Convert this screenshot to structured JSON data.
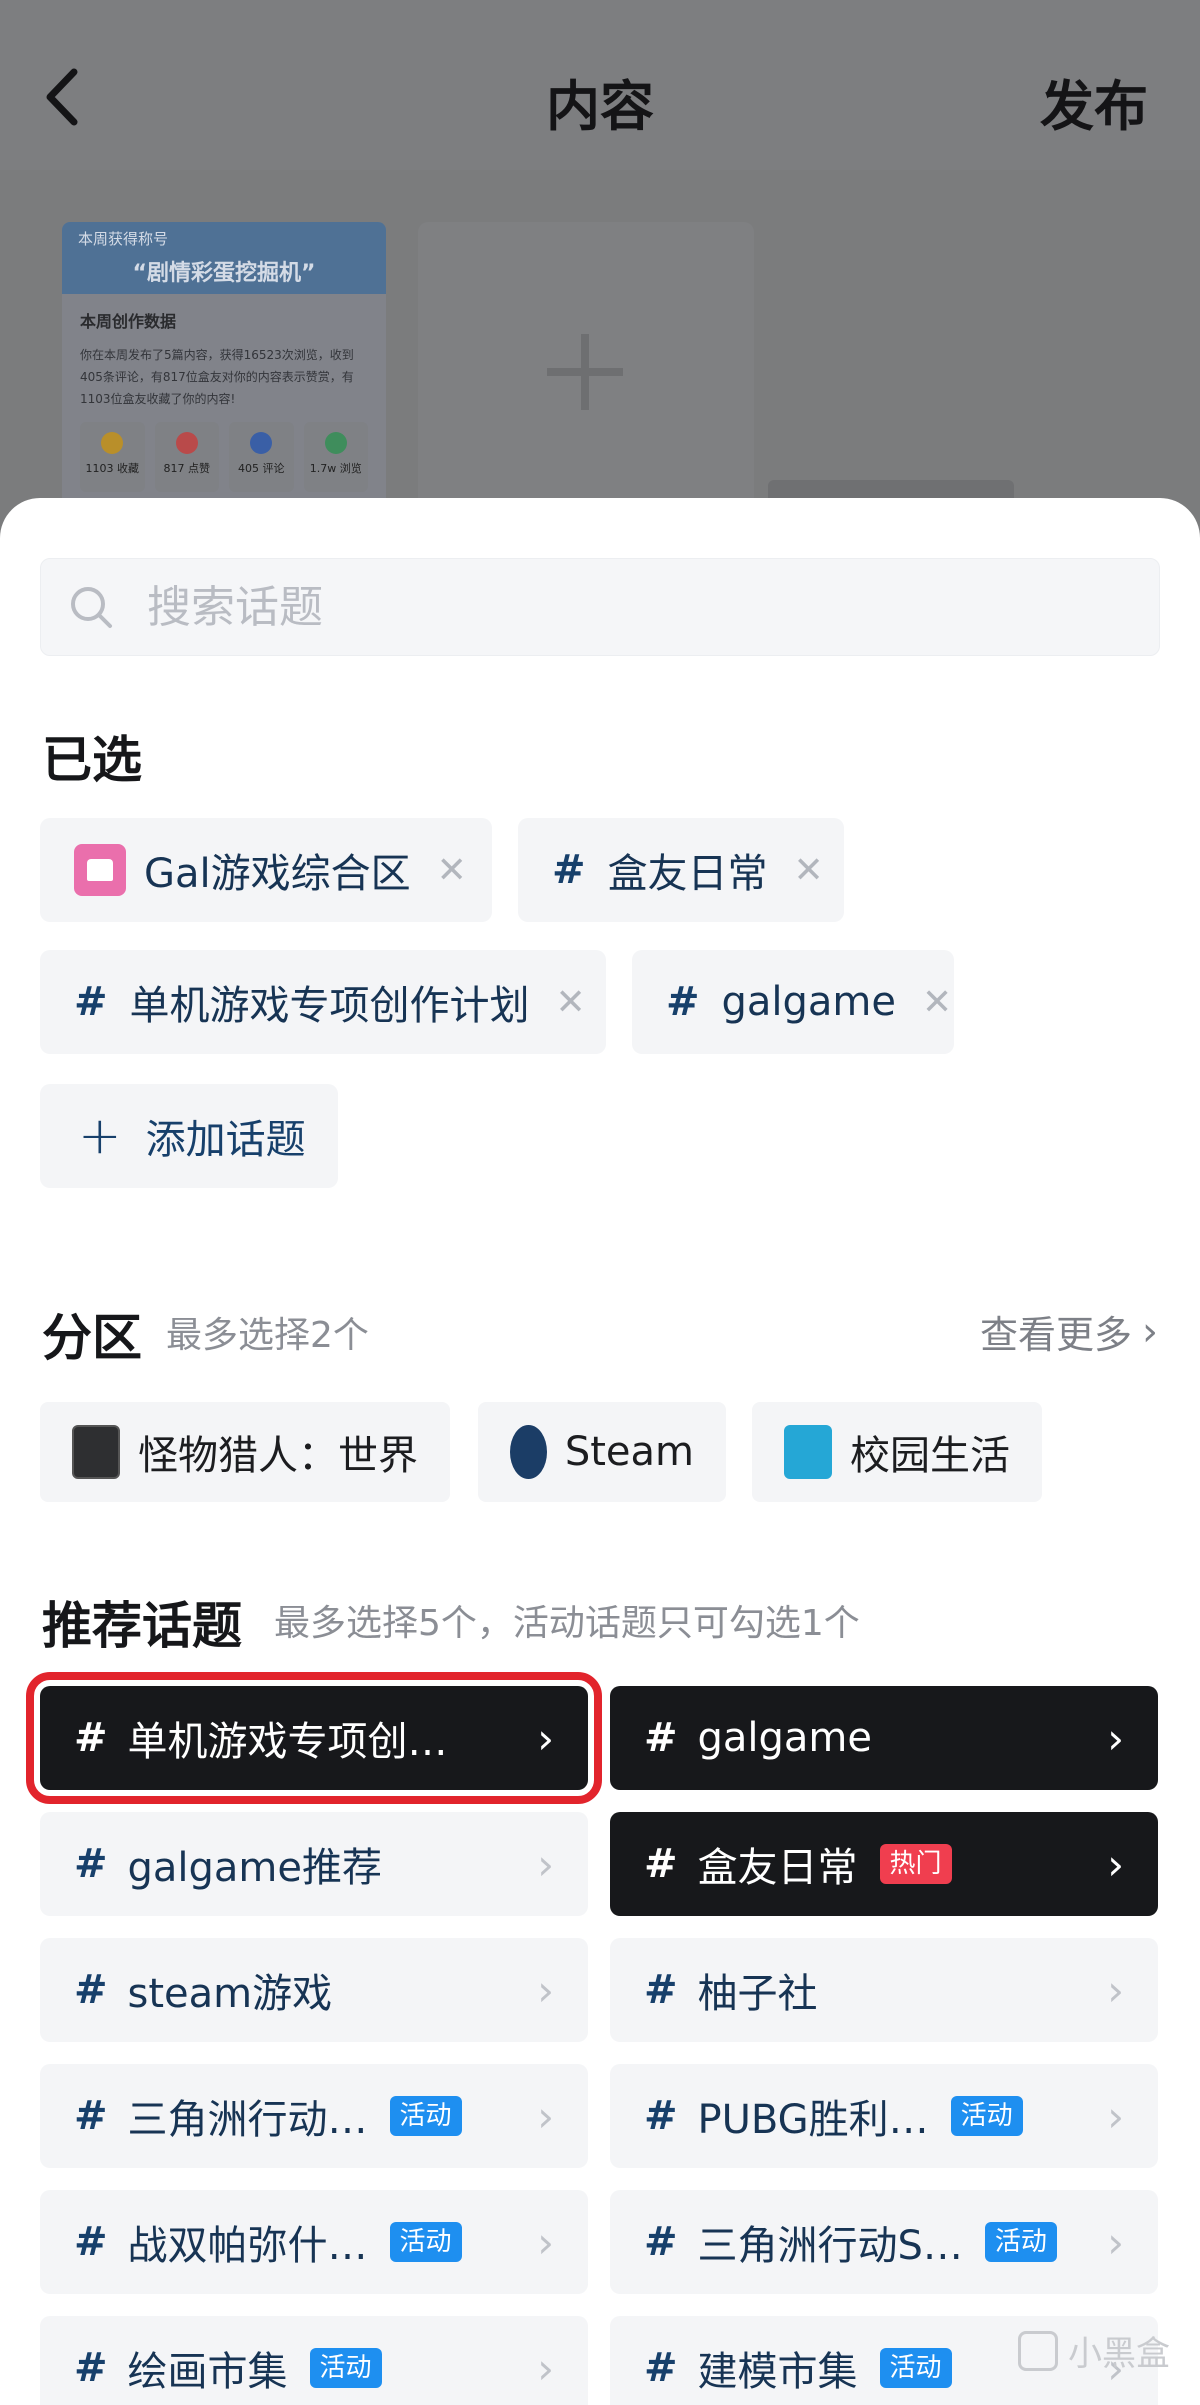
{
  "header": {
    "title": "内容",
    "publish_label": "发布"
  },
  "preview_card": {
    "label": "本周获得称号",
    "badge_title": "“剧情彩蛋挖掘机”",
    "section": "本周创作数据",
    "text": "你在本周发布了5篇内容，获得16523次浏览，收到405条评论，有817位盒友对你的内容表示赞赏，有1103位盒友收藏了你的内容!",
    "stats": [
      {
        "value": "1103",
        "label": "收藏",
        "icon": "star-icon"
      },
      {
        "value": "817",
        "label": "点赞",
        "icon": "thumb-icon"
      },
      {
        "value": "405",
        "label": "评论",
        "icon": "comment-icon"
      },
      {
        "value": "1.7w",
        "label": "浏览",
        "icon": "eye-icon"
      }
    ]
  },
  "search": {
    "placeholder": "搜索话题",
    "value": ""
  },
  "selected": {
    "title": "已选",
    "items": [
      {
        "label": "Gal游戏综合区",
        "type": "zone"
      },
      {
        "label": "盒友日常",
        "type": "topic"
      },
      {
        "label": "单机游戏专项创作计划",
        "type": "topic"
      },
      {
        "label": "galgame",
        "type": "topic"
      }
    ],
    "add_label": "添加话题"
  },
  "zones": {
    "title": "分区",
    "hint": "最多选择2个",
    "more_label": "查看更多",
    "items": [
      {
        "label": "怪物猎人：世界",
        "icon": "monster-hunter-icon"
      },
      {
        "label": "Steam",
        "icon": "steam-icon"
      },
      {
        "label": "校园生活",
        "icon": "campus-icon"
      }
    ]
  },
  "recommended": {
    "title": "推荐话题",
    "hint": "最多选择5个，活动话题只可勾选1个",
    "items": [
      {
        "label": "单机游戏专项创…",
        "badge": "",
        "selected": true
      },
      {
        "label": "galgame",
        "badge": "",
        "selected": true
      },
      {
        "label": "galgame推荐",
        "badge": "",
        "selected": false
      },
      {
        "label": "盒友日常",
        "badge": "热门",
        "selected": true
      },
      {
        "label": "steam游戏",
        "badge": "",
        "selected": false
      },
      {
        "label": "柚子社",
        "badge": "",
        "selected": false
      },
      {
        "label": "三角洲行动…",
        "badge": "活动",
        "selected": false
      },
      {
        "label": "PUBG胜利…",
        "badge": "活动",
        "selected": false
      },
      {
        "label": "战双帕弥什…",
        "badge": "活动",
        "selected": false
      },
      {
        "label": "三角洲行动S…",
        "badge": "活动",
        "selected": false
      },
      {
        "label": "绘画市集",
        "badge": "活动",
        "selected": false
      },
      {
        "label": "建模市集",
        "badge": "活动",
        "selected": false
      }
    ]
  },
  "watermark": "小黑盒",
  "colors": {
    "accent": "#17406b",
    "selected_dark": "#17181b",
    "highlight": "#e2242c",
    "event_badge": "#1e8ff0",
    "hot_badge": "#f03e4f"
  }
}
